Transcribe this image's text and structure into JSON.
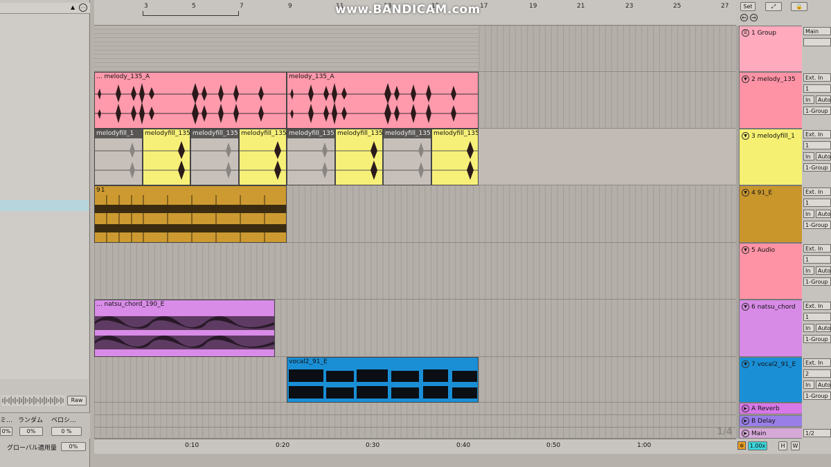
{
  "watermark": "www.BANDICAM.com",
  "left_panel": {
    "raw_button": "Raw",
    "groove_headers": [
      "ミ…",
      "ランダム",
      "ベロシ…"
    ],
    "groove_values": [
      "0%",
      "0%",
      "0 %"
    ],
    "global_amount_label": "グローバル適用量",
    "global_amount_value": "0%"
  },
  "ruler": {
    "bars": [
      "3",
      "5",
      "7",
      "9",
      "11",
      "13",
      "15",
      "17",
      "19",
      "21",
      "23",
      "25",
      "27"
    ],
    "set_label": "Set"
  },
  "time_ruler": {
    "labels": [
      "0:10",
      "0:20",
      "0:30",
      "0:40",
      "0:50",
      "1:00"
    ],
    "grid_fraction": "1/4"
  },
  "tracks": [
    {
      "name": "1 Group",
      "io": [
        "Main"
      ]
    },
    {
      "name": "2 melody_135",
      "io": [
        "Ext. In",
        "1",
        "In",
        "Auto",
        "1-Group"
      ]
    },
    {
      "name": "3 melodyfill_1",
      "io": [
        "Ext. In",
        "1",
        "In",
        "Auto",
        "1-Group"
      ]
    },
    {
      "name": "4 91_E",
      "io": [
        "Ext. In",
        "1",
        "In",
        "Auto",
        "1-Group"
      ]
    },
    {
      "name": "5 Audio",
      "io": [
        "Ext. In",
        "1",
        "In",
        "Auto",
        "1-Group"
      ]
    },
    {
      "name": "6 natsu_chord",
      "io": [
        "Ext. In",
        "1",
        "In",
        "Auto",
        "1-Group"
      ]
    },
    {
      "name": "7 vocal2_91_E",
      "io": [
        "Ext. In",
        "2",
        "In",
        "Auto",
        "1-Group"
      ]
    }
  ],
  "returns": [
    {
      "name": "A Reverb"
    },
    {
      "name": "B Delay"
    },
    {
      "name": "Main",
      "io": "1/2"
    }
  ],
  "clips": {
    "melody": [
      "... melody_135_A",
      "melody_135_A"
    ],
    "melodyfill": [
      "melodyfill_1",
      "melodyfill_135",
      "melodyfill_135",
      "melodyfill_135",
      "melodyfill_135",
      "melodyfill_135",
      "melodyfill_135",
      "melodyfill_135"
    ],
    "drum_label": "91",
    "chord": "... natsu_chord_190_E",
    "vocal": "vocal2_91_E"
  },
  "bottom_right": {
    "zoom": "1.00x",
    "h": "H",
    "w": "W"
  },
  "colors": {
    "group": "#ffaabd",
    "melody": "#ff93a6",
    "melodyfill": "#f5f071",
    "drum": "#c9962c",
    "audio": "#ff93a6",
    "chord": "#d78ae6",
    "vocal": "#1a8fd6",
    "reverb": "#d878e6",
    "delay": "#9a7ee8",
    "main": "#d6a8d8"
  }
}
